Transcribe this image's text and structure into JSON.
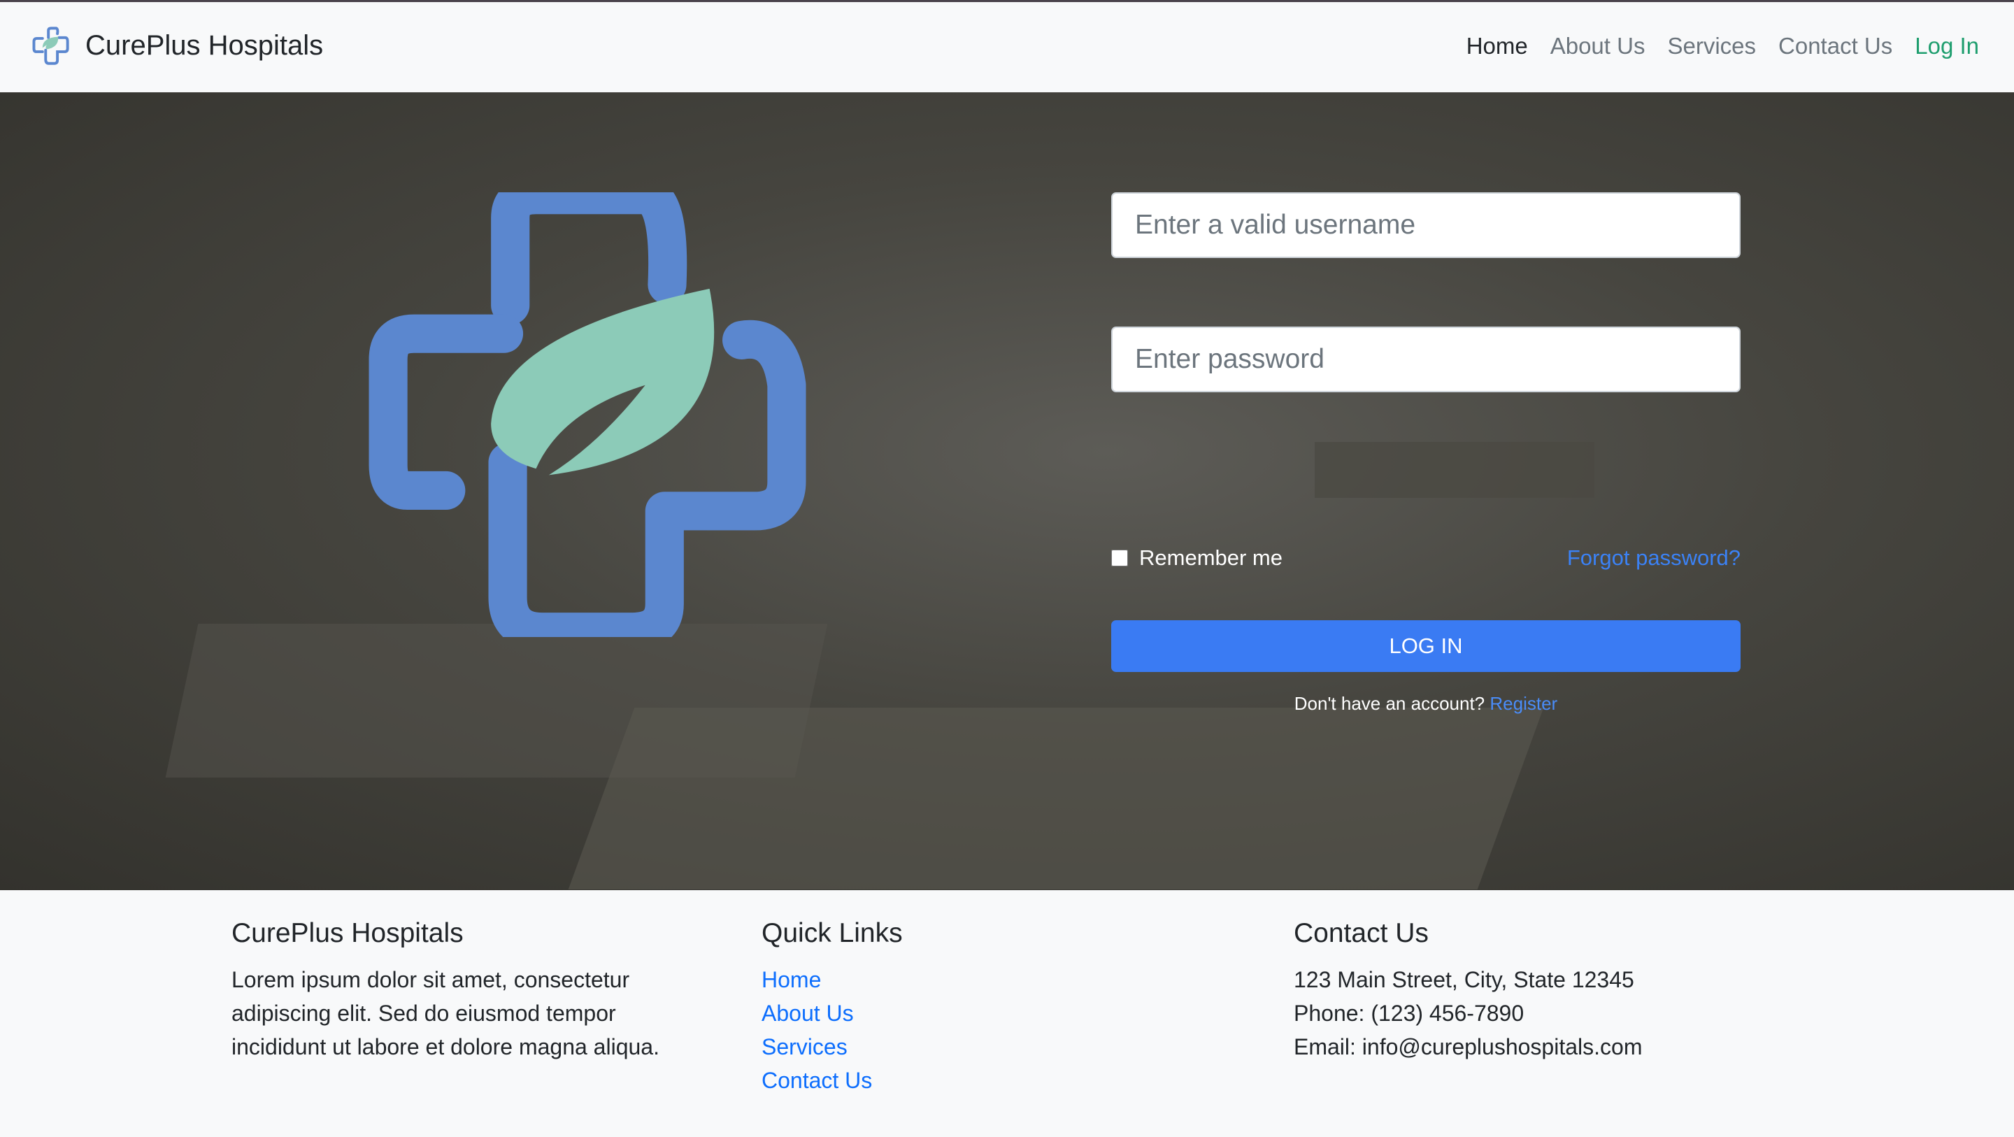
{
  "navbar": {
    "brand": "CurePlus Hospitals",
    "links": [
      "Home",
      "About Us",
      "Services",
      "Contact Us",
      "Log In"
    ],
    "active": "Home"
  },
  "login": {
    "username_placeholder": "Enter a valid username",
    "password_placeholder": "Enter password",
    "remember_label": "Remember me",
    "remember_checked": false,
    "forgot": "Forgot password?",
    "button": "LOG IN",
    "no_account": "Don't have an account?",
    "register": "Register"
  },
  "footer": {
    "about": {
      "title": "CurePlus Hospitals",
      "text": "Lorem ipsum dolor sit amet, consectetur adipiscing elit. Sed do eiusmod tempor incididunt ut labore et dolore magna aliqua."
    },
    "quick": {
      "title": "Quick Links",
      "links": [
        "Home",
        "About Us",
        "Services",
        "Contact Us"
      ]
    },
    "contact": {
      "title": "Contact Us",
      "address": "123 Main Street, City, State 12345",
      "phone": "Phone: (123) 456-7890",
      "email": "Email: info@cureplushospitals.com"
    }
  },
  "colors": {
    "brand_blue": "#5b87cf",
    "leaf_teal": "#8ccbb8",
    "button": "#3a7bf3",
    "login_link": "#1e9e6e"
  }
}
